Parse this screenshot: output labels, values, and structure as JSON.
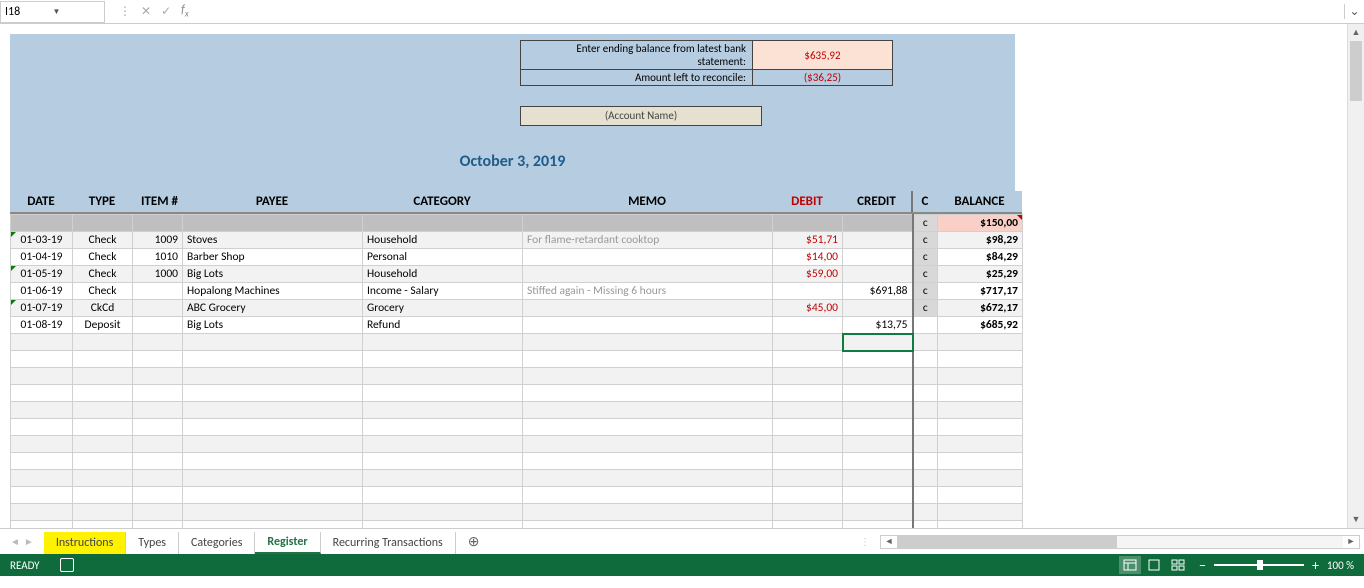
{
  "formula": {
    "cellref": "I18",
    "value": ""
  },
  "recon": {
    "label1": "Enter ending balance from latest bank statement:",
    "val1": "$635,92",
    "label2": "Amount left to reconcile:",
    "val2": "($36,25)"
  },
  "account_name": "(Account Name)",
  "date_title": "October 3, 2019",
  "headers": {
    "date": "DATE",
    "type": "TYPE",
    "item": "ITEM #",
    "payee": "PAYEE",
    "category": "CATEGORY",
    "memo": "MEMO",
    "debit": "DEBIT",
    "credit": "CREDIT",
    "c": "C",
    "balance": "BALANCE"
  },
  "start_c": "c",
  "start_balance": "$150,00",
  "rows": [
    {
      "date": "01-03-19",
      "type": "Check",
      "item": "1009",
      "payee": "Stoves",
      "category": "Household",
      "memo": "For flame-retardant cooktop",
      "debit": "$51,71",
      "credit": "",
      "c": "c",
      "balance": "$98,29",
      "tri": true
    },
    {
      "date": "01-04-19",
      "type": "Check",
      "item": "1010",
      "payee": "Barber Shop",
      "category": "Personal",
      "memo": "",
      "debit": "$14,00",
      "credit": "",
      "c": "c",
      "balance": "$84,29",
      "tri": false
    },
    {
      "date": "01-05-19",
      "type": "Check",
      "item": "1000",
      "payee": "Big Lots",
      "category": "Household",
      "memo": "",
      "debit": "$59,00",
      "credit": "",
      "c": "c",
      "balance": "$25,29",
      "tri": true
    },
    {
      "date": "01-06-19",
      "type": "Check",
      "item": "",
      "payee": "Hopalong Machines",
      "category": "Income - Salary",
      "memo": "Stiffed again - Missing 6 hours",
      "debit": "",
      "credit": "$691,88",
      "c": "c",
      "balance": "$717,17",
      "tri": false
    },
    {
      "date": "01-07-19",
      "type": "CkCd",
      "item": "",
      "payee": "ABC Grocery",
      "category": "Grocery",
      "memo": "",
      "debit": "$45,00",
      "credit": "",
      "c": "c",
      "balance": "$672,17",
      "tri": true
    },
    {
      "date": "01-08-19",
      "type": "Deposit",
      "item": "",
      "payee": "Big Lots",
      "category": "Refund",
      "memo": "",
      "debit": "",
      "credit": "$13,75",
      "c": "",
      "balance": "$685,92",
      "tri": false
    }
  ],
  "sheet_tabs": [
    "Instructions",
    "Types",
    "Categories",
    "Register",
    "Recurring Transactions"
  ],
  "active_tab": 3,
  "highlight_tab": 0,
  "status": {
    "ready": "READY",
    "zoom": "100 %"
  }
}
